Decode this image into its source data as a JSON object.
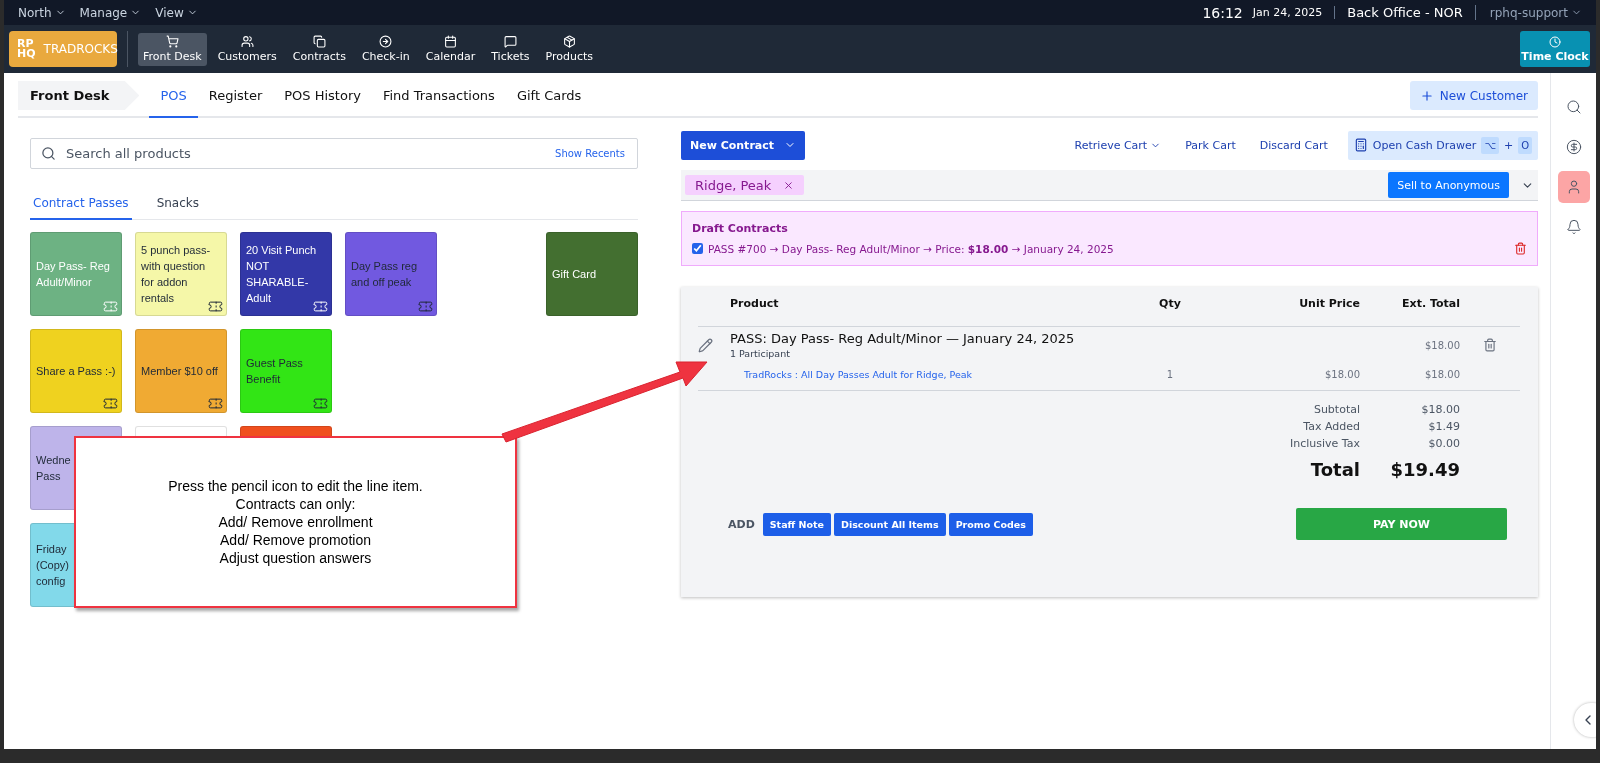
{
  "top_bar": {
    "menus": [
      "North",
      "Manage",
      "View"
    ],
    "time": "16:12",
    "date": "Jan 24, 2025",
    "location": "Back Office - NOR",
    "user": "rphq-support"
  },
  "nav": {
    "logo_lines": [
      "RP",
      "HQ"
    ],
    "brand": "TRADROCKS",
    "time_clock": "Time Clock",
    "items": [
      {
        "label": "Front Desk",
        "kind": "cart",
        "selected": true
      },
      {
        "label": "Customers",
        "kind": "users",
        "selected": false
      },
      {
        "label": "Contracts",
        "kind": "copy",
        "selected": false
      },
      {
        "label": "Check-in",
        "kind": "arrow",
        "selected": false
      },
      {
        "label": "Calendar",
        "kind": "calendar",
        "selected": false
      },
      {
        "label": "Tickets",
        "kind": "message",
        "selected": false
      },
      {
        "label": "Products",
        "kind": "box",
        "selected": false
      }
    ]
  },
  "subnav": {
    "section": "Front Desk",
    "new_customer": "New Customer",
    "tabs": [
      {
        "label": "POS",
        "selected": true
      },
      {
        "label": "Register",
        "selected": false
      },
      {
        "label": "POS History",
        "selected": false
      },
      {
        "label": "Find Transactions",
        "selected": false
      },
      {
        "label": "Gift Cards",
        "selected": false
      }
    ]
  },
  "products": {
    "search": {
      "placeholder": "Search all products"
    },
    "show_recents": "Show Recents",
    "tabs": [
      {
        "label": "Contract Passes",
        "selected": true
      },
      {
        "label": "Snacks",
        "selected": false
      }
    ],
    "tile_rows": [
      [
        {
          "label": "Day Pass- Reg Adult/Minor",
          "color": "#6db283",
          "light_text": true,
          "kind": "pass"
        },
        {
          "label": "5 punch pass- with question for addon rentals",
          "color": "#f5f7a8",
          "light_text": false,
          "kind": "pass"
        },
        {
          "label": "20 Visit Punch NOT SHARABLE- Adult",
          "color": "#3338a8",
          "light_text": true,
          "kind": "pass"
        },
        {
          "label": "Day Pass reg and off peak",
          "color": "#7159e0",
          "light_text": false,
          "kind": "pass"
        },
        {
          "label": "Gift Card",
          "color": "#436f30",
          "light_text": true,
          "kind": "gift_card"
        }
      ],
      [
        {
          "label": "Share a Pass :-)",
          "color": "#efd21f",
          "light_text": false,
          "kind": "pass"
        },
        {
          "label": "Member $10 off",
          "color": "#f0aa33",
          "light_text": false,
          "kind": "pass"
        },
        {
          "label": "Guest Pass Benefit",
          "color": "#32e515",
          "light_text": false,
          "kind": "pass"
        }
      ],
      [
        {
          "label": "Wedne\nPass",
          "color": "#beb4ea",
          "light_text": false,
          "kind": "covered"
        },
        {
          "color": "#ffffff",
          "kind": "covered"
        },
        {
          "color": "#f0501e",
          "kind": "covered"
        }
      ],
      [
        {
          "label": "Friday\n(Copy)\nconfig",
          "color": "#82d9ea",
          "light_text": false,
          "kind": "covered"
        }
      ]
    ]
  },
  "cart": {
    "new_contract": "New Contract",
    "actions": [
      {
        "label": "Retrieve Cart",
        "kind": "dropdown"
      },
      {
        "label": "Park Cart",
        "kind": "plain"
      },
      {
        "label": "Discard Cart",
        "kind": "plain"
      }
    ],
    "cash_drawer": {
      "label": "Open Cash Drawer",
      "keys": [
        "⌥",
        "O"
      ],
      "joiner": "+"
    },
    "customer": "Ridge, Peak",
    "sell_anonymous": "Sell to Anonymous",
    "draft": {
      "title": "Draft Contracts",
      "items": [
        {
          "checked": true,
          "text": "PASS #700 → Day Pass- Reg Adult/Minor → Price: **$18.00** → January 24, 2025"
        }
      ]
    },
    "columns": [
      "Product",
      "Qty",
      "Unit Price",
      "Ext. Total"
    ],
    "line": {
      "title": "PASS: Day Pass- Reg Adult/Minor — January 24, 2025",
      "subtitle": "1 Participant",
      "ext_total": "$18.00",
      "detail": {
        "product": "TradRocks : All Day Passes Adult for Ridge, Peak",
        "qty": "1",
        "unit_price": "$18.00",
        "ext_total": "$18.00"
      }
    },
    "totals": [
      {
        "label": "Subtotal",
        "value": "$18.00"
      },
      {
        "label": "Tax Added",
        "value": "$1.49"
      },
      {
        "label": "Inclusive Tax",
        "value": "$0.00"
      }
    ],
    "total": {
      "label": "Total",
      "value": "$19.49"
    },
    "add_label": "ADD",
    "add_buttons": [
      "Staff Note",
      "Discount All Items",
      "Promo Codes"
    ],
    "pay": "PAY NOW"
  },
  "sidebar": [
    {
      "kind": "search",
      "selected": false
    },
    {
      "kind": "dollar",
      "selected": false
    },
    {
      "kind": "person",
      "selected": true
    },
    {
      "kind": "bell",
      "selected": false
    }
  ],
  "callout": {
    "lines": [
      "Press the pencil icon to edit the line item.",
      "Contracts can only:",
      "Add/ Remove enrollment",
      "Add/ Remove promotion",
      "Adjust question answers"
    ]
  }
}
